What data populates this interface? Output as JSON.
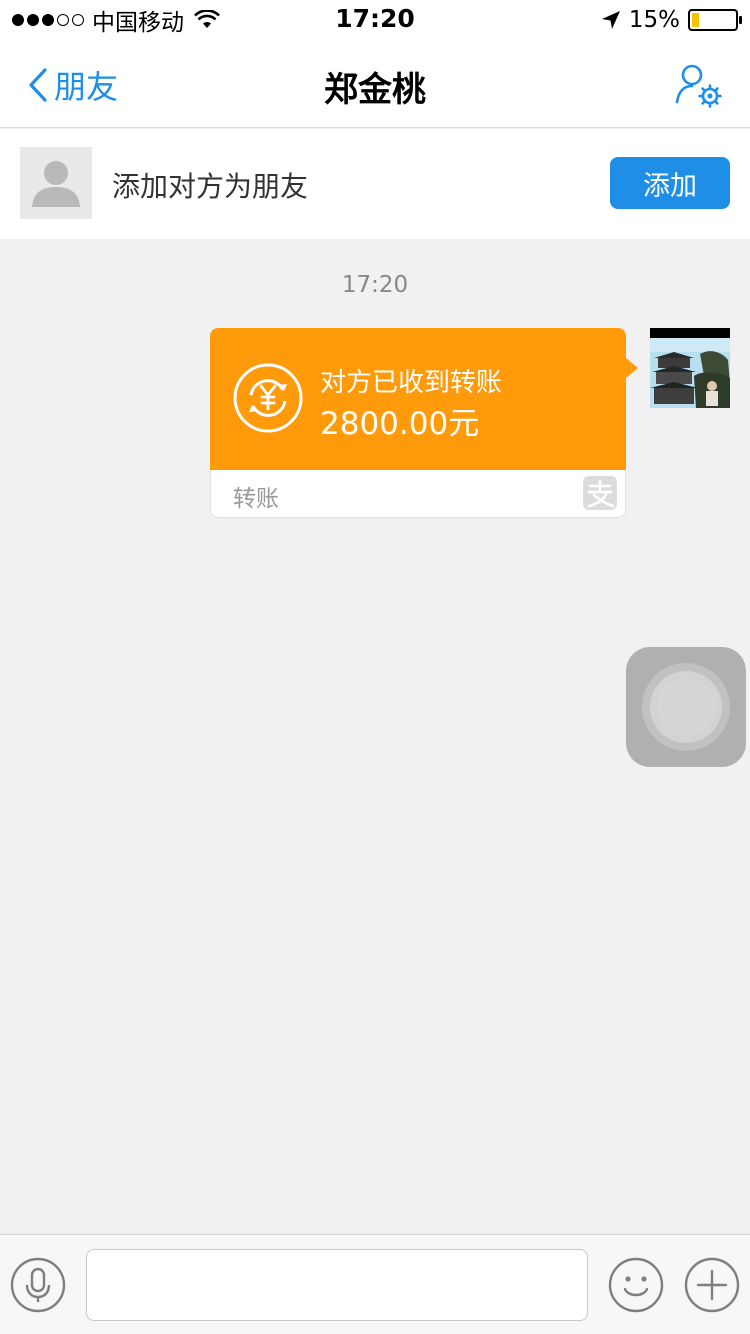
{
  "status_bar": {
    "carrier": "中国移动",
    "time": "17:20",
    "battery_percent": "15%",
    "battery_level": 0.15,
    "signal_bars": 3,
    "signal_total": 5
  },
  "nav": {
    "back_label": "朋友",
    "title": "郑金桃"
  },
  "add_friend": {
    "prompt": "添加对方为朋友",
    "button_label": "添加"
  },
  "chat": {
    "timestamp": "17:20",
    "transfer": {
      "status": "对方已收到转账",
      "amount": "2800.00元",
      "label": "转账"
    }
  },
  "input_bar": {
    "placeholder": "",
    "value": ""
  },
  "colors": {
    "accent": "#1e8ee6",
    "transfer_orange": "#ff9a0a",
    "battery": "#f5c400"
  }
}
